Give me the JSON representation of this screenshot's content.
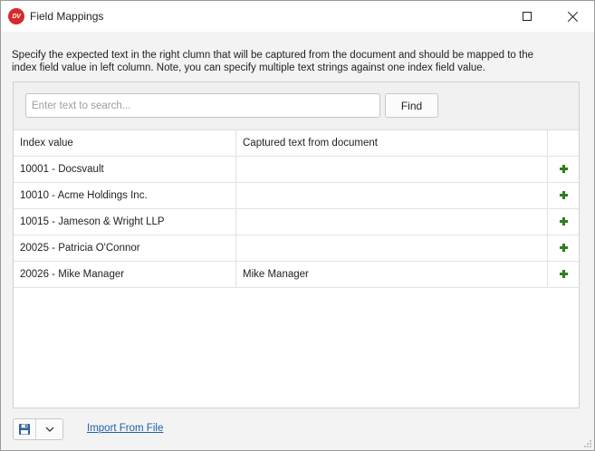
{
  "window": {
    "logo_text": "DV",
    "title": "Field Mappings"
  },
  "description": "Specify the expected text in the right clumn that will be captured from the document and should be mapped to the index field value in left column. Note, you can specify multiple text strings against one index field value.",
  "search": {
    "placeholder": "Enter text to search...",
    "value": "",
    "find_label": "Find"
  },
  "grid": {
    "columns": [
      "Index value",
      "Captured text from document"
    ],
    "rows": [
      {
        "index": "10001 - Docsvault",
        "captured": ""
      },
      {
        "index": "10010 - Acme Holdings Inc.",
        "captured": ""
      },
      {
        "index": "10015 - Jameson & Wright LLP",
        "captured": ""
      },
      {
        "index": "20025 - Patricia O'Connor",
        "captured": ""
      },
      {
        "index": "20026 - Mike Manager",
        "captured": "Mike Manager"
      }
    ],
    "row_action_icon": "plus-icon"
  },
  "footer": {
    "save_icon": "floppy-disk-icon",
    "dropdown_icon": "chevron-down-icon",
    "import_label": "Import From File"
  },
  "colors": {
    "accent_link": "#1f5fa8",
    "add_icon": "#2e7d1e",
    "logo": "#d62a2a"
  }
}
